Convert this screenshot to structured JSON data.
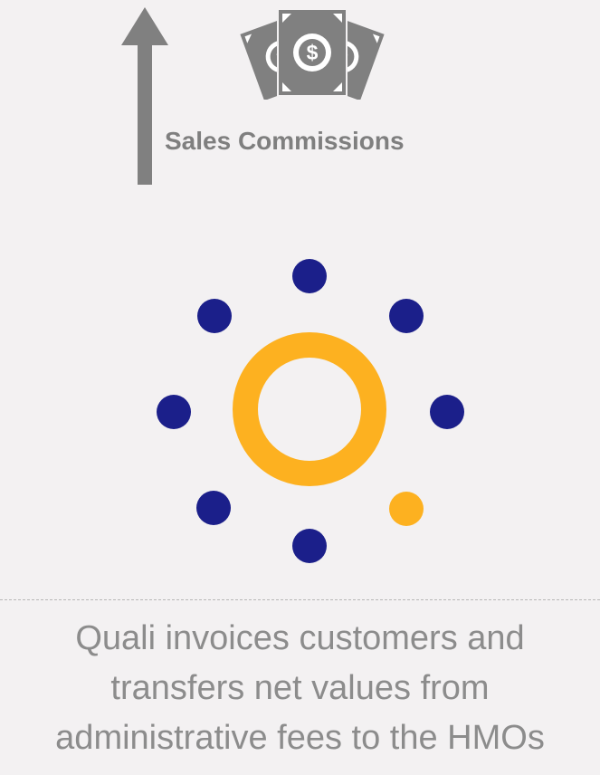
{
  "labels": {
    "commission": "Sales Commissions"
  },
  "caption": {
    "line1": "Quali invoices customers and",
    "line2": "transfers net values from",
    "line3": "administrative fees to the HMOs"
  },
  "icons": {
    "arrow": "up-arrow-icon",
    "money": "money-bills-icon",
    "hub": "ring-hub-icon"
  },
  "colors": {
    "background": "#f3f1f2",
    "gray": "#808080",
    "navy": "#1b1f8a",
    "gold": "#fdb120",
    "caption_text": "#8c8c8c"
  }
}
